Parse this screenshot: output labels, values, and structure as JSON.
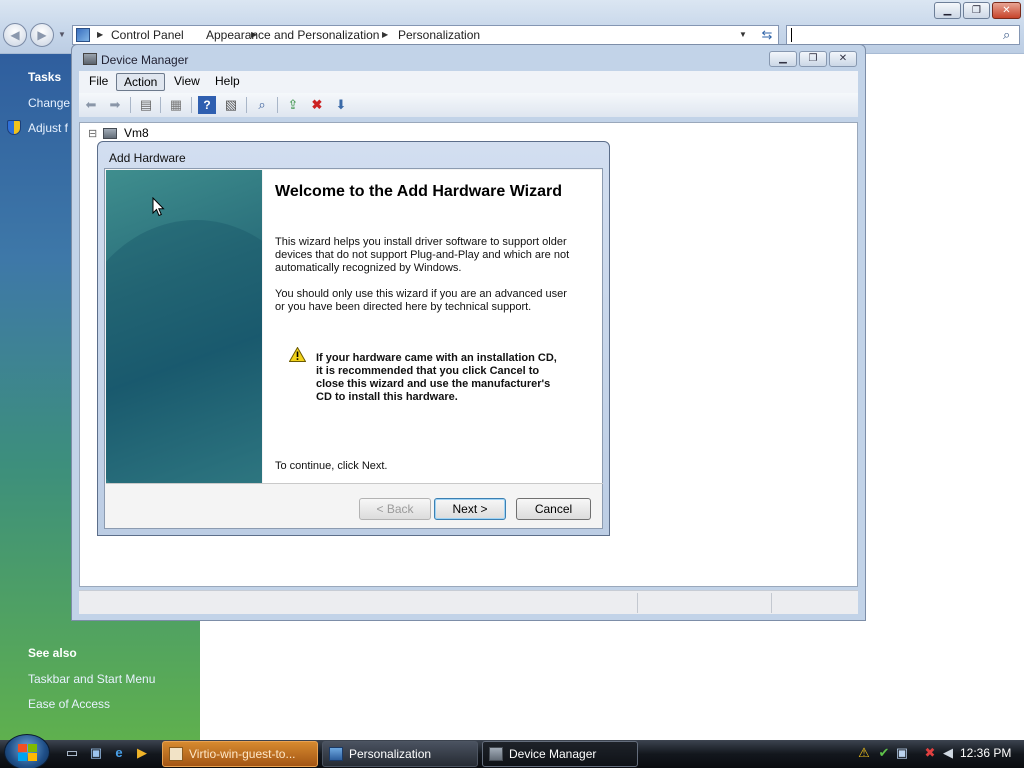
{
  "explorer": {
    "breadcrumb": [
      "Control Panel",
      "Appearance and Personalization",
      "Personalization"
    ],
    "window_buttons": {
      "minimize": "▁",
      "maximize": "❐",
      "close": "✕"
    },
    "left_pane": {
      "tasks_heading": "Tasks",
      "tasks": [
        "Change",
        "Adjust f"
      ],
      "see_also_heading": "See also",
      "see_also": [
        "Taskbar and Start Menu",
        "Ease of Access"
      ]
    }
  },
  "device_manager": {
    "title": "Device Manager",
    "menu": [
      "File",
      "Action",
      "View",
      "Help"
    ],
    "tree_root": "Vm8",
    "tree_expander": "⊟"
  },
  "wizard": {
    "title": "Add Hardware",
    "heading": "Welcome to the Add Hardware Wizard",
    "para1": [
      "This wizard helps you install driver software to support older",
      "devices that do not support Plug-and-Play and which are not",
      "automatically recognized by Windows."
    ],
    "para2": [
      "You should only use this wizard if you are an advanced user",
      "or you have been directed here by technical support."
    ],
    "warning": [
      "If your hardware came with an installation CD,",
      "it is recommended that you click Cancel to",
      "close this wizard and use the manufacturer's",
      "CD to install this hardware."
    ],
    "continue_text": "To continue, click Next.",
    "buttons": {
      "back": "< Back",
      "next": "Next >",
      "cancel": "Cancel"
    }
  },
  "taskbar": {
    "tasks": [
      "Virtio-win-guest-to...",
      "Personalization",
      "Device Manager"
    ],
    "clock": "12:36 PM"
  },
  "colors": {
    "flash_task": "#c9701f",
    "warning_icon": "#f2d21b"
  }
}
